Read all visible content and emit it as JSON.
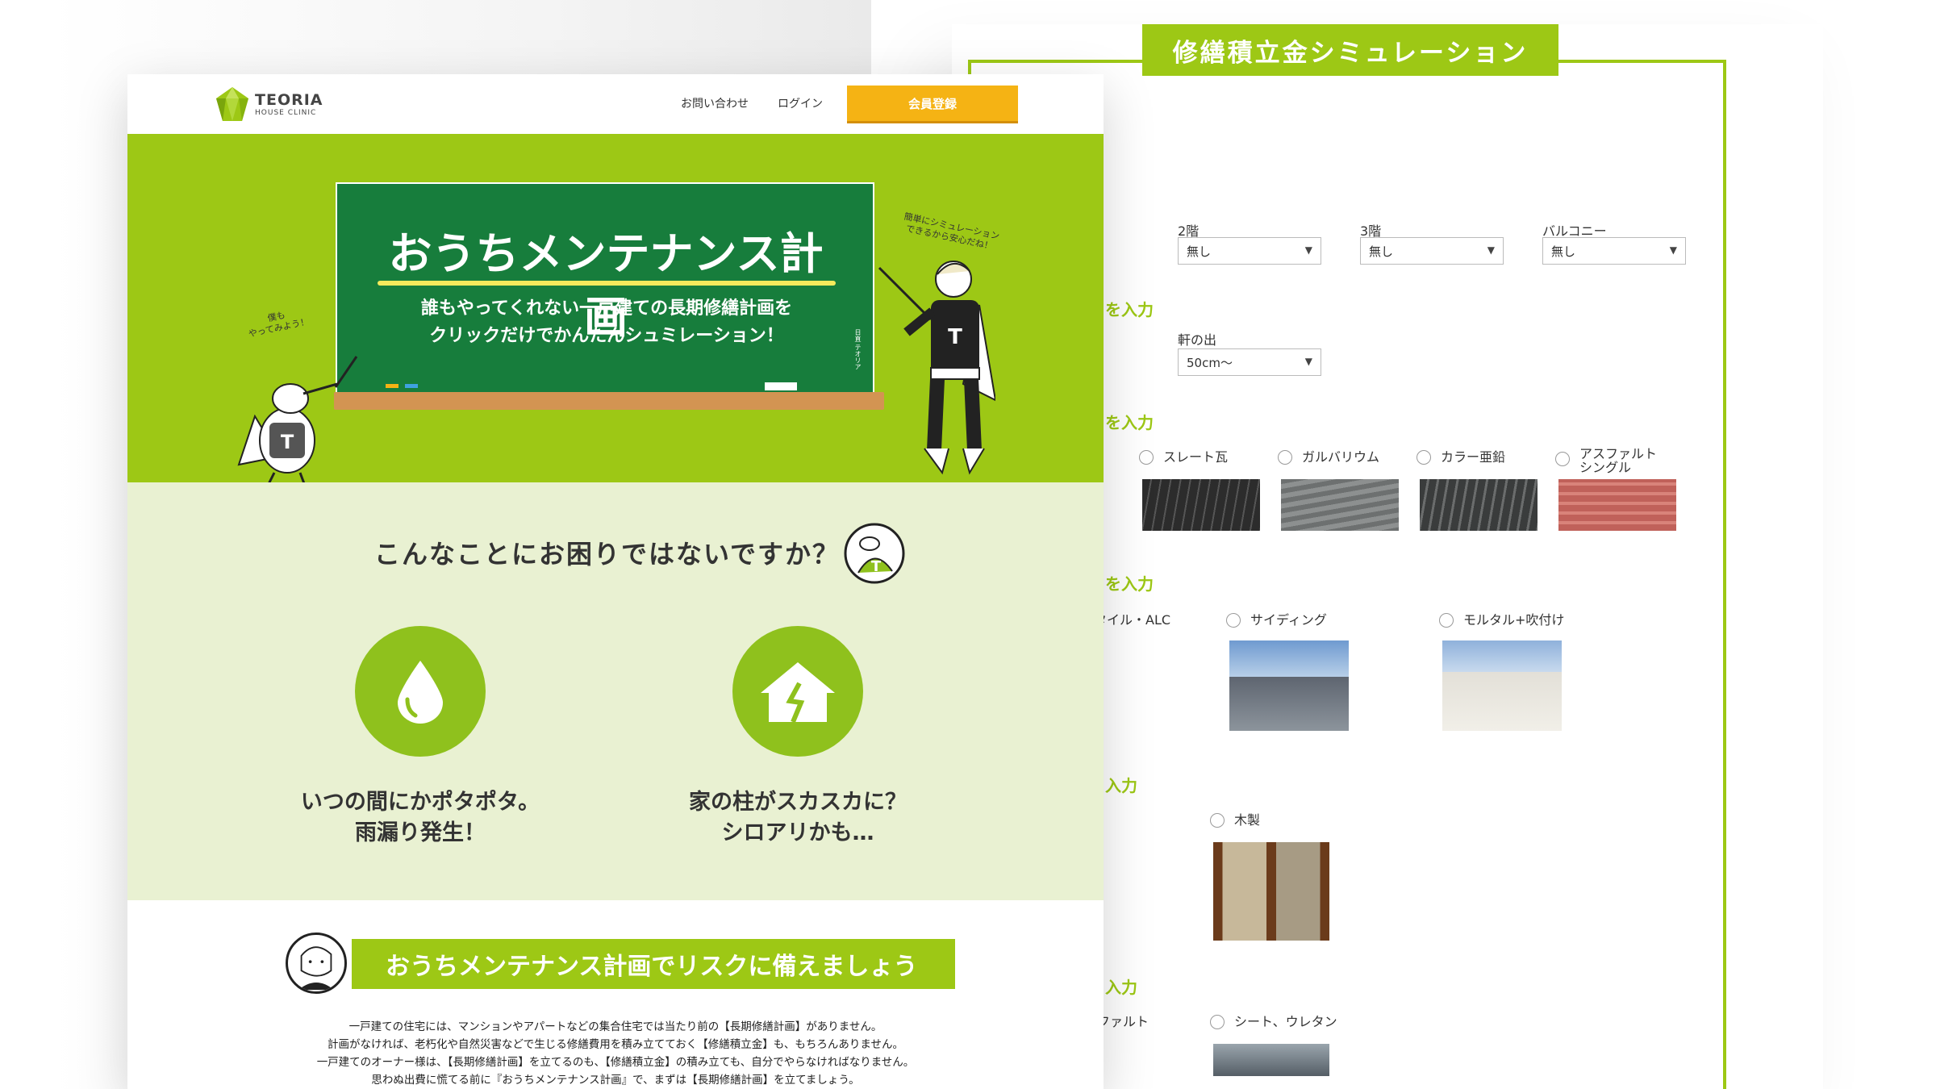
{
  "back_panel": {
    "title": "修繕積立金シミュレーション",
    "floor_labels": [
      "2階",
      "3階",
      "バルコニー"
    ],
    "floor_values": [
      "無し",
      "無し",
      "無し"
    ],
    "eaves_label": "軒の出",
    "eaves_value": "50cm〜",
    "section_titles": [
      "を入力",
      "を入力",
      "を入力",
      "入力",
      "入力"
    ],
    "roof_options": [
      "スレート瓦",
      "ガルバリウム",
      "カラー亜鉛",
      "アスファルト\nシングル"
    ],
    "wall_options": [
      "タイル・ALC",
      "サイディング",
      "モルタル+吹付け"
    ],
    "window_option": "木製",
    "balcony_options": [
      "ファルト",
      "シート、ウレタン"
    ]
  },
  "front_page": {
    "logo_main": "TEORIA",
    "logo_sub": "HOUSE CLINIC",
    "nav_contact": "お問い合わせ",
    "nav_login": "ログイン",
    "register_button": "会員登録",
    "hero_title": "おうちメンテナンス計画",
    "hero_sub1": "誰もやってくれない一戸建ての長期修繕計画を",
    "hero_sub2": "クリックだけでかんたんシュミレーション！",
    "board_credit": "日直 テオリア",
    "speech_left": "僕も\nやってみよう！",
    "speech_right": "簡単にシミュレーション\nできるから安心だね！",
    "trouble_heading": "こんなことにお困りではないですか？",
    "trouble_items": [
      {
        "line1": "いつの間にかポタポタ。",
        "line2": "雨漏り発生！"
      },
      {
        "line1": "家の柱がスカスカに？",
        "line2": "シロアリかも…"
      }
    ],
    "banner_title": "おうちメンテナンス計画でリスクに備えましょう",
    "body_lines": [
      "一戸建ての住宅には、マンションやアパートなどの集合住宅では当たり前の【長期修繕計画】がありません。",
      "計画がなければ、老朽化や自然災害などで生じる修繕費用を積み立てておく【修繕積立金】も、もちろんありません。",
      "一戸建てのオーナー様は、【長期修繕計画】を立てるのも、【修繕積立金】の積み立ても、自分でやらなければなりません。",
      "思わぬ出費に慌てる前に『おうちメンテナンス計画』で、まずは【長期修繕計画】を立てましょう。"
    ]
  },
  "colors": {
    "accent_green": "#9dc815",
    "board_green": "#177d3c",
    "orange": "#f5b314",
    "pale_green": "#e9f1d2"
  }
}
